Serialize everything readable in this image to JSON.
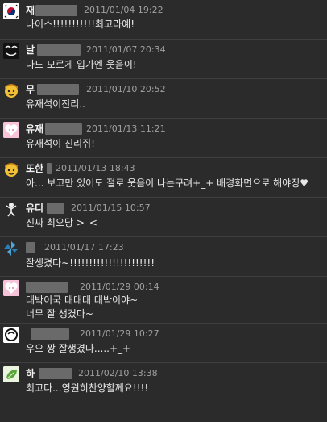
{
  "comments": [
    {
      "name": "재",
      "date": "2011/01/04 19:22",
      "text": "나이스!!!!!!!!!!!최고라예!",
      "avatar": "flag-korea-icon",
      "color": "#ffffff"
    },
    {
      "name": "날",
      "date": "2011/01/07 20:34",
      "text": "나도 모르게 입가엔 웃음이!",
      "avatar": "sticker-text-icon",
      "color": "#111111"
    },
    {
      "name": "무",
      "date": "2011/01/10 20:52",
      "text": "유재석이진리..",
      "avatar": "yellow-face-icon",
      "color": "#e8a91e"
    },
    {
      "name": "유재",
      "date": "2011/01/13 11:21",
      "text": "유재석이 진리쥐!",
      "avatar": "pink-heart-face-icon",
      "color": "#f28bb8"
    },
    {
      "name": "또한",
      "date": "2011/01/13 18:43",
      "text": "아... 보고만 있어도 절로 웃음이 나는구려+_+ 배경화면으로 해야징♥",
      "avatar": "yellow-face-icon",
      "color": "#e8a91e"
    },
    {
      "name": "유디",
      "date": "2011/01/15 10:57",
      "text": "진짜 최오당 >_<",
      "avatar": "stick-figure-icon",
      "color": "#2a2a2a"
    },
    {
      "name": "",
      "date": "2011/01/17 17:23",
      "text": "잘생겼다~!!!!!!!!!!!!!!!!!!!!!!",
      "avatar": "pinwheel-icon",
      "color": "#1e6fa3"
    },
    {
      "name": "",
      "date": "2011/01/29 00:14",
      "text": "대박이국 대대대 대박이야~",
      "text2": "너무 잘 생겼다~",
      "avatar": "pink-heart-face-icon",
      "color": "#f28bb8"
    },
    {
      "name": "",
      "date": "2011/01/29 10:27",
      "text": "우오 짱 잘생겼다.....+_+",
      "avatar": "outline-face-icon",
      "color": "#ffffff"
    },
    {
      "name": "하",
      "date": "2011/02/10 13:38",
      "text": "최고다...영원히찬양할께요!!!!",
      "avatar": "leaf-icon",
      "color": "#e9f5df"
    }
  ]
}
